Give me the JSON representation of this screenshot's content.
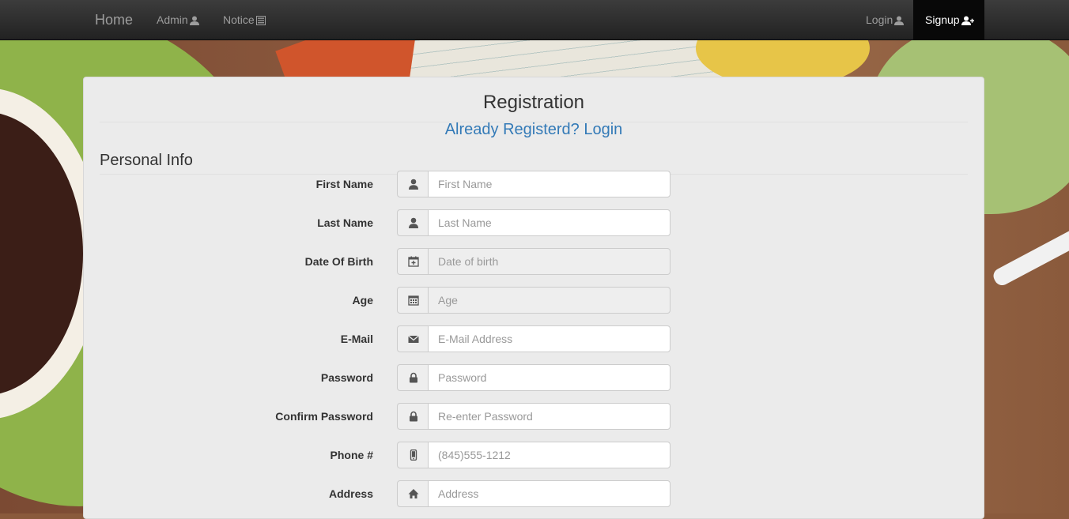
{
  "nav": {
    "brand": "Home",
    "admin": "Admin",
    "notice": "Notice",
    "login": "Login",
    "signup": "Signup"
  },
  "form": {
    "title": "Registration",
    "login_link": "Already Registerd? Login",
    "section": "Personal Info",
    "fields": [
      {
        "label": "First Name",
        "placeholder": "First Name",
        "icon": "user-icon"
      },
      {
        "label": "Last Name",
        "placeholder": "Last Name",
        "icon": "user-icon"
      },
      {
        "label": "Date Of Birth",
        "placeholder": "Date of birth",
        "icon": "calendar-plus-icon"
      },
      {
        "label": "Age",
        "placeholder": "Age",
        "icon": "calendar-icon"
      },
      {
        "label": "E-Mail",
        "placeholder": "E-Mail Address",
        "icon": "envelope-icon"
      },
      {
        "label": "Password",
        "placeholder": "Password",
        "icon": "lock-icon"
      },
      {
        "label": "Confirm Password",
        "placeholder": "Re-enter Password",
        "icon": "lock-icon"
      },
      {
        "label": "Phone #",
        "placeholder": "(845)555-1212",
        "icon": "phone-icon"
      },
      {
        "label": "Address",
        "placeholder": "Address",
        "icon": "home-icon"
      }
    ]
  },
  "colors": {
    "navbar": "#222222",
    "link": "#337ab7",
    "panel": "#ebebeb"
  }
}
